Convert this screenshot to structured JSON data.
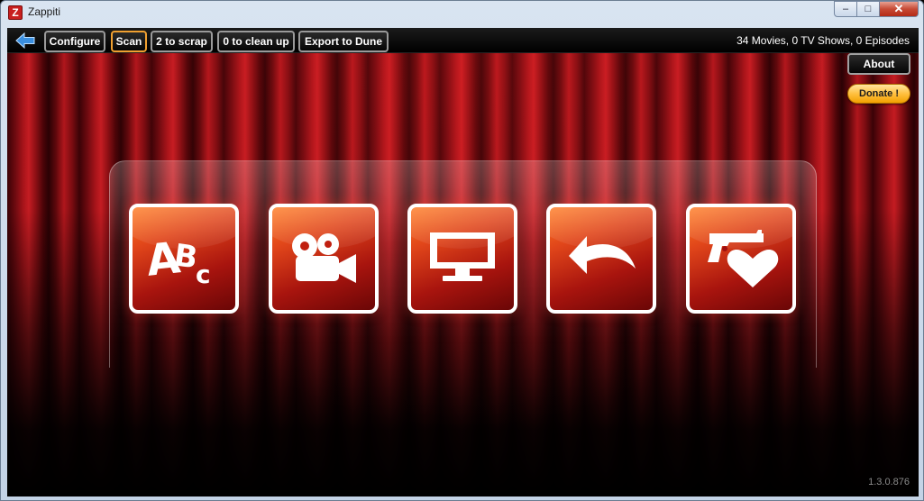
{
  "window": {
    "title": "Zappiti",
    "app_icon_letter": "Z",
    "controls": {
      "minimize": "–",
      "restore": "□",
      "close": "✕"
    }
  },
  "toolbar": {
    "back_icon": "back-arrow-icon",
    "configure_label": "Configure",
    "scan_label": "Scan",
    "scrap_label": "2 to scrap",
    "cleanup_label": "0 to clean up",
    "export_label": "Export to Dune",
    "stats": "34 Movies, 0 TV Shows, 0 Episodes"
  },
  "side": {
    "about_label": "About",
    "donate_label": "Donate !"
  },
  "tiles": [
    {
      "icon": "abc-icon"
    },
    {
      "icon": "movie-camera-icon"
    },
    {
      "icon": "tv-monitor-icon"
    },
    {
      "icon": "back-curved-arrow-icon"
    },
    {
      "icon": "gun-heart-icon"
    }
  ],
  "version": "1.3.0.876",
  "colors": {
    "accent_active": "#f0a030",
    "donate": "#ffc040",
    "tile_orange": "#e0451a",
    "tile_dark_red": "#6a0606"
  }
}
